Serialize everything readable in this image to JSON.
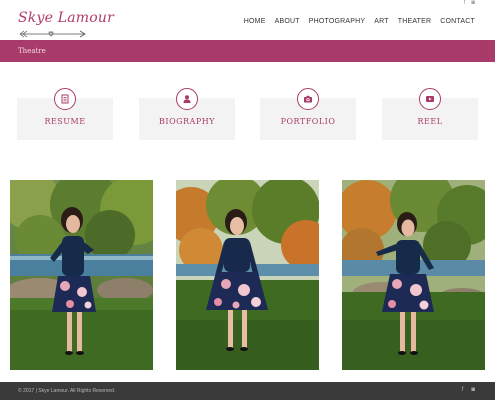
{
  "brand": {
    "logo_text": "Skye Lamour",
    "accent": "#a83b6a"
  },
  "top_social": [
    {
      "icon": "facebook-icon",
      "glyph": "f"
    },
    {
      "icon": "instagram-icon",
      "glyph": "◙"
    }
  ],
  "nav": {
    "items": [
      "HOME",
      "ABOUT",
      "PHOTOGRAPHY",
      "ART",
      "THEATER",
      "CONTACT"
    ]
  },
  "page": {
    "title": "Theatre"
  },
  "cards": [
    {
      "label": "RESUME",
      "icon": "document-icon"
    },
    {
      "label": "BIOGRAPHY",
      "icon": "person-icon"
    },
    {
      "label": "PORTFOLIO",
      "icon": "camera-icon"
    },
    {
      "label": "REEL",
      "icon": "video-play-icon"
    }
  ],
  "photos": [
    {
      "name": "photo-1"
    },
    {
      "name": "photo-2"
    },
    {
      "name": "photo-3"
    }
  ],
  "footer": {
    "copyright": "© 2017 | Skye Lamour. All Rights Reserved.",
    "social": [
      {
        "icon": "facebook-icon",
        "glyph": "f"
      },
      {
        "icon": "instagram-icon",
        "glyph": "◙"
      }
    ]
  }
}
